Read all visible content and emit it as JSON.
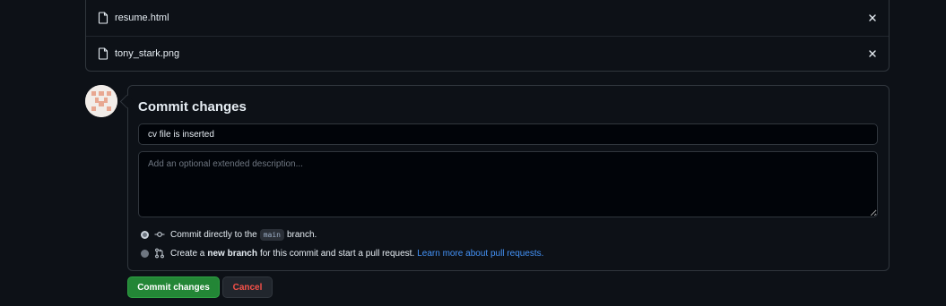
{
  "files": [
    {
      "name": "resume.html"
    },
    {
      "name": "tony_stark.png"
    }
  ],
  "commit": {
    "title": "Commit changes",
    "summary_value": "cv file is inserted",
    "description_placeholder": "Add an optional extended description...",
    "option_direct": {
      "prefix": "Commit directly to the",
      "branch": "main",
      "suffix": "branch."
    },
    "option_new_branch": {
      "prefix": "Create a",
      "bold": "new branch",
      "suffix": "for this commit and start a pull request.",
      "link": "Learn more about pull requests."
    }
  },
  "buttons": {
    "commit_label": "Commit changes",
    "cancel_label": "Cancel"
  },
  "colors": {
    "background": "#0d1117",
    "commit_button": "#238636",
    "cancel_text": "#f85149",
    "link": "#4493f8"
  },
  "icons": [
    "file-icon",
    "close-icon",
    "git-commit-icon",
    "git-pull-request-icon"
  ]
}
